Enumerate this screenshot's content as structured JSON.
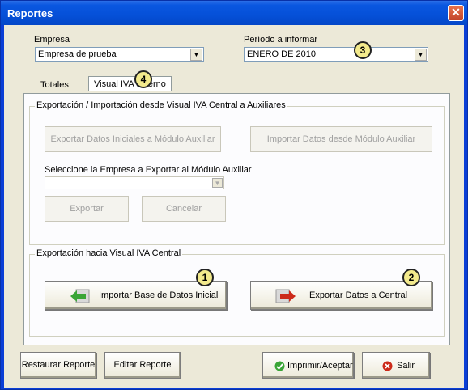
{
  "window": {
    "title": "Reportes",
    "close_glyph": "✕"
  },
  "empresa": {
    "label": "Empresa",
    "value": "Empresa de prueba"
  },
  "periodo": {
    "label": "Período a informar",
    "value": "ENERO DE 2010"
  },
  "tabs": [
    {
      "label": "Totales"
    },
    {
      "label": "Visual IVA externo"
    }
  ],
  "export_group": {
    "title": "Exportación / Importación desde Visual IVA Central a Auxiliares",
    "export_initial_label": "Exportar Datos Iniciales a Módulo Auxiliar",
    "import_label": "Importar Datos desde Módulo Auxiliar",
    "select_label": "Seleccione la Empresa a Exportar al Módulo Auxiliar",
    "select_value": "",
    "exportar_label": "Exportar",
    "cancelar_label": "Cancelar"
  },
  "central_group": {
    "title": "Exportación hacia Visual IVA Central",
    "import_base_label": "Importar Base de Datos Inicial",
    "export_central_label": "Exportar Datos a Central"
  },
  "footer": {
    "restaurar_label": "Restaurar Reporte",
    "editar_label": "Editar Reporte",
    "imprimir_label": "Imprimir/Aceptar",
    "salir_label": "Salir"
  },
  "badges": [
    "1",
    "2",
    "3",
    "4"
  ],
  "icons": {
    "close": "close-icon",
    "dropdown": "chevron-down-icon",
    "import_arrow": "green-left-arrow-icon",
    "export_arrow": "red-right-arrow-icon",
    "ok": "green-check-icon",
    "exit": "red-x-icon"
  },
  "colors": {
    "titlebar": "#0550d8",
    "client": "#ece9d8",
    "badge": "#f3ea8c"
  }
}
